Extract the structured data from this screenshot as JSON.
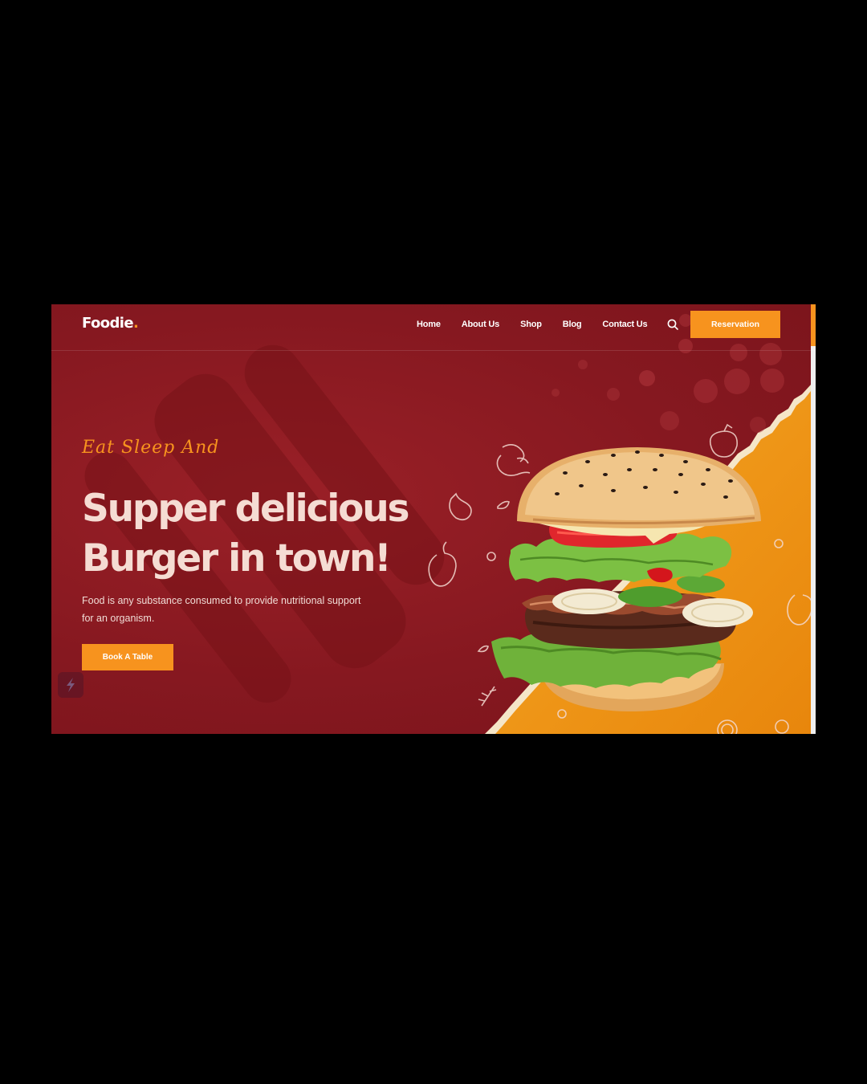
{
  "brand": {
    "name": "Foodie",
    "dot": "."
  },
  "nav": {
    "items": [
      "Home",
      "About Us",
      "Shop",
      "Blog",
      "Contact Us"
    ],
    "search_icon": "search-icon",
    "reservation_label": "Reservation"
  },
  "hero": {
    "tagline": "Eat Sleep And",
    "headline_line1": "Supper delicious",
    "headline_line2": "Burger in town!",
    "description": "Food is any substance consumed to provide nutritional support for an organism.",
    "cta_label": "Book A Table"
  },
  "decor": {
    "food_icons": [
      "shrimp-icon",
      "garlic-icon",
      "pepper-icon",
      "tomato-icon",
      "leaf-icon",
      "herb-icon"
    ],
    "plugin_icon": "lightning-icon"
  },
  "colors": {
    "primary_red": "#8e1a20",
    "accent_orange": "#f7931e",
    "headline_color": "#f5dcd3"
  }
}
